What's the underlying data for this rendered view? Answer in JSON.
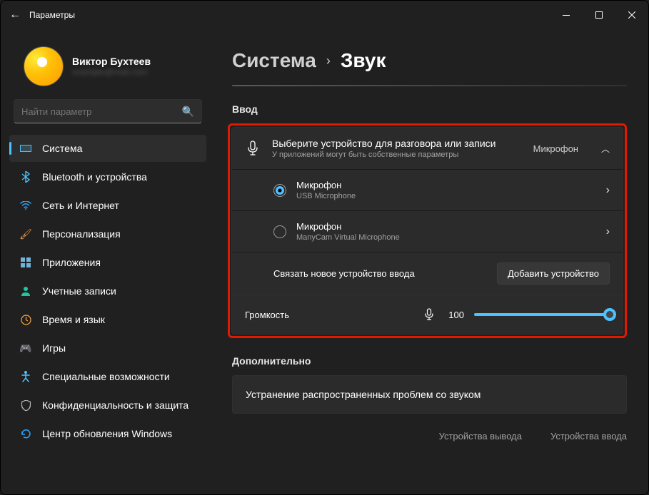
{
  "window": {
    "title": "Параметры"
  },
  "user": {
    "name": "Виктор Бухтеев",
    "email": "example@mail.com"
  },
  "search": {
    "placeholder": "Найти параметр"
  },
  "nav": {
    "items": [
      {
        "label": "Система"
      },
      {
        "label": "Bluetooth и устройства"
      },
      {
        "label": "Сеть и Интернет"
      },
      {
        "label": "Персонализация"
      },
      {
        "label": "Приложения"
      },
      {
        "label": "Учетные записи"
      },
      {
        "label": "Время и язык"
      },
      {
        "label": "Игры"
      },
      {
        "label": "Специальные возможности"
      },
      {
        "label": "Конфиденциальность и защита"
      },
      {
        "label": "Центр обновления Windows"
      }
    ]
  },
  "breadcrumb": {
    "parent": "Система",
    "current": "Звук"
  },
  "sections": {
    "input_label": "Ввод",
    "advanced_label": "Дополнительно"
  },
  "input_card": {
    "title": "Выберите устройство для разговора или записи",
    "subtitle": "У приложений могут быть собственные параметры",
    "current": "Микрофон",
    "devices": [
      {
        "name": "Микрофон",
        "desc": "USB Microphone",
        "selected": true
      },
      {
        "name": "Микрофон",
        "desc": "ManyCam Virtual Microphone",
        "selected": false
      }
    ],
    "pair_text": "Связать новое устройство ввода",
    "add_btn": "Добавить устройство"
  },
  "volume": {
    "label": "Громкость",
    "value": "100"
  },
  "troubleshoot": {
    "title": "Устранение распространенных проблем со звуком"
  },
  "adv_links": {
    "out": "Устройства вывода",
    "in": "Устройства ввода"
  }
}
